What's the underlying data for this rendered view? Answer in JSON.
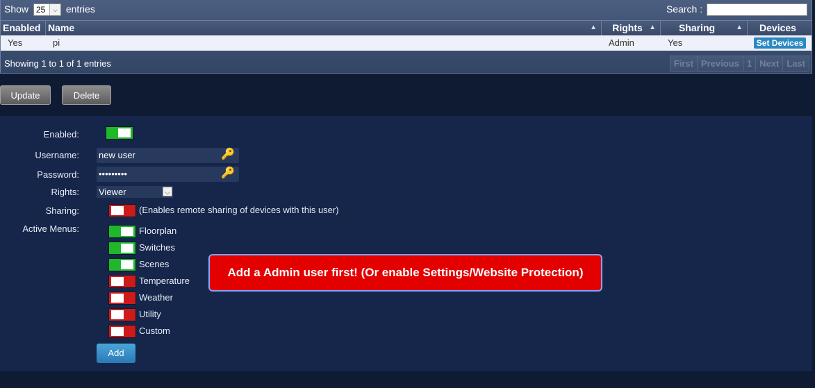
{
  "table": {
    "show_label": "Show",
    "entries_label": "entries",
    "page_size": "25",
    "search_label": "Search :",
    "search_value": "",
    "columns": [
      "Enabled",
      "Name",
      "Rights",
      "Sharing",
      "Devices"
    ],
    "rows": [
      {
        "enabled": "Yes",
        "name": "pi",
        "rights": "Admin",
        "sharing": "Yes",
        "action": "Set Devices"
      }
    ],
    "info": "Showing 1 to 1 of 1 entries",
    "pager": [
      "First",
      "Previous",
      "1",
      "Next",
      "Last"
    ]
  },
  "actions": {
    "update": "Update",
    "delete": "Delete"
  },
  "form": {
    "enabled_label": "Enabled:",
    "enabled": true,
    "username_label": "Username:",
    "username_value": "new user",
    "password_label": "Password:",
    "password_value": "•••••••••",
    "rights_label": "Rights:",
    "rights_value": "Viewer",
    "sharing_label": "Sharing:",
    "sharing": false,
    "sharing_note": "(Enables remote sharing of devices with this user)",
    "active_menus_label": "Active Menus:",
    "menus": [
      {
        "label": "Floorplan",
        "on": true
      },
      {
        "label": "Switches",
        "on": true
      },
      {
        "label": "Scenes",
        "on": true
      },
      {
        "label": "Temperature",
        "on": false
      },
      {
        "label": "Weather",
        "on": false
      },
      {
        "label": "Utility",
        "on": false
      },
      {
        "label": "Custom",
        "on": false
      }
    ],
    "add_label": "Add"
  },
  "alert": "Add a Admin user first! (Or enable Settings/Website Protection)",
  "colors": {
    "on": "#1fb82a",
    "off": "#cf1a1a",
    "alert": "#e30000",
    "accent": "#2b89c2"
  },
  "icons": {
    "field_icon": "key-icon",
    "select_arrow": "chevron-down-icon",
    "sort": "sort-arrow-icon"
  }
}
